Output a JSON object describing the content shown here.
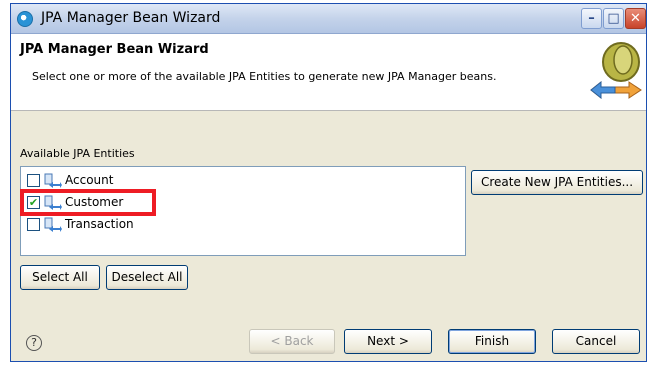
{
  "window": {
    "title": "JPA Manager Bean Wizard"
  },
  "banner": {
    "title": "JPA Manager Bean Wizard",
    "description": "Select one or more of the available JPA Entities to generate new JPA Manager beans."
  },
  "entities": {
    "label": "Available JPA Entities",
    "items": [
      {
        "label": "Account",
        "checked": false
      },
      {
        "label": "Customer",
        "checked": true
      },
      {
        "label": "Transaction",
        "checked": false
      }
    ]
  },
  "buttons": {
    "create_new": "Create New JPA Entities...",
    "select_all": "Select All",
    "deselect_all": "Deselect All",
    "back": "< Back",
    "next": "Next >",
    "finish": "Finish",
    "cancel": "Cancel"
  },
  "icons": {
    "app": "eclipse-icon",
    "help": "help-icon",
    "entity": "entity-icon",
    "wizard": "jpa-bean-wizard-graphic"
  },
  "colors": {
    "highlight": "#ee1c24",
    "check": "#21a121"
  }
}
